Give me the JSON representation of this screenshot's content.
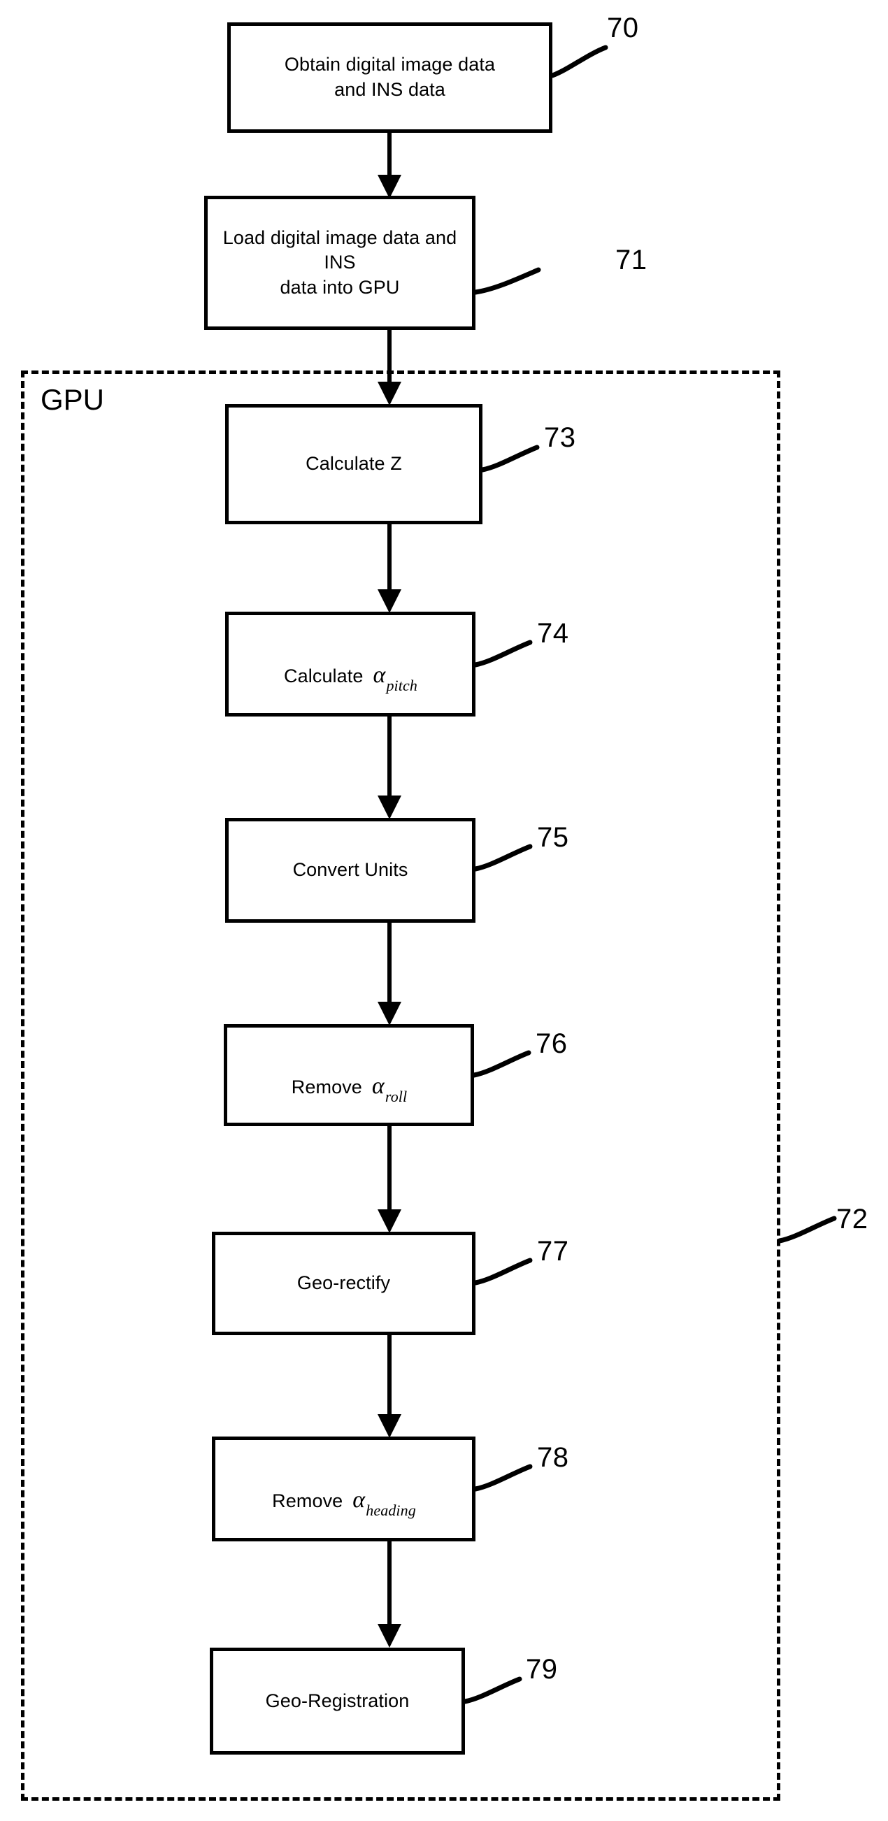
{
  "figure": {
    "title": "GPU geo-registration processing flowchart",
    "line_color": "#000000",
    "background_color": "#ffffff"
  },
  "group": {
    "label": "GPU",
    "ref": "72"
  },
  "steps": [
    {
      "id": "step-70",
      "ref": "70",
      "text": "Obtain digital image data\nand INS data",
      "math": null
    },
    {
      "id": "step-71",
      "ref": "71",
      "text": "Load digital image data and INS\ndata into GPU",
      "math": null
    },
    {
      "id": "step-73",
      "ref": "73",
      "text": "Calculate Z",
      "math": null
    },
    {
      "id": "step-74",
      "ref": "74",
      "text": "Calculate",
      "math": {
        "symbol": "α",
        "subscript": "pitch"
      }
    },
    {
      "id": "step-75",
      "ref": "75",
      "text": "Convert Units",
      "math": null
    },
    {
      "id": "step-76",
      "ref": "76",
      "text": "Remove",
      "math": {
        "symbol": "α",
        "subscript": "roll"
      }
    },
    {
      "id": "step-77",
      "ref": "77",
      "text": "Geo-rectify",
      "math": null
    },
    {
      "id": "step-78",
      "ref": "78",
      "text": "Remove",
      "math": {
        "symbol": "α",
        "subscript": "heading"
      }
    },
    {
      "id": "step-79",
      "ref": "79",
      "text": "Geo-Registration",
      "math": null
    }
  ]
}
